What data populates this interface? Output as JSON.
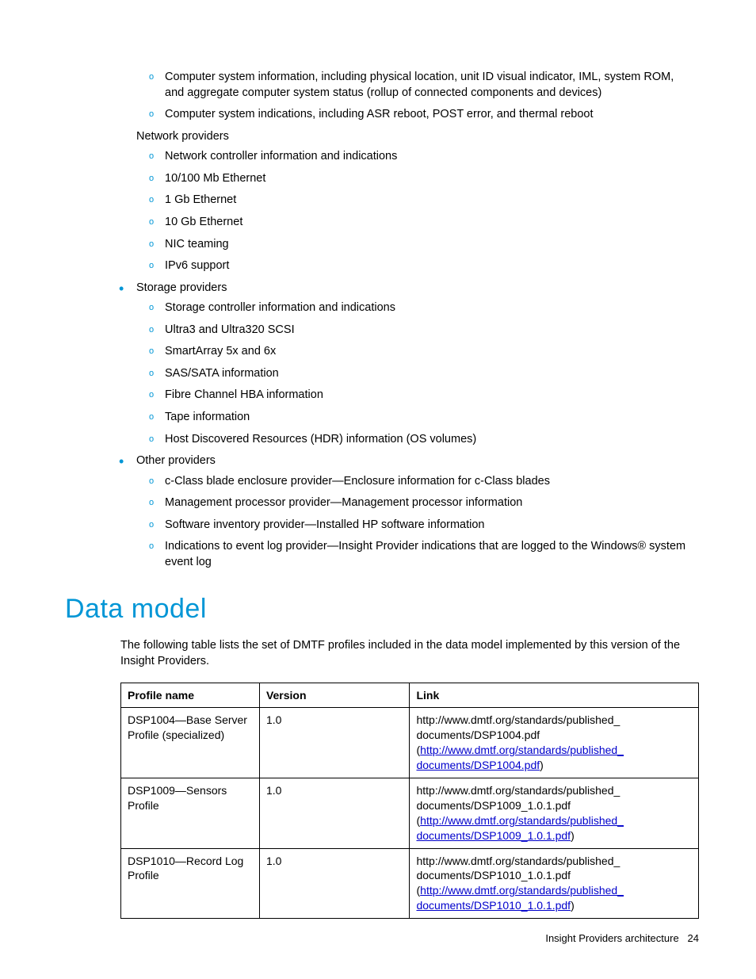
{
  "lists": {
    "orphan_level2_a": [
      "Computer system information, including physical location, unit ID visual indicator, IML, system ROM, and aggregate computer system status (rollup of connected components and devices)",
      "Computer system indications, including ASR reboot, POST error, and thermal reboot"
    ],
    "bullets": [
      {
        "label": "Network providers",
        "items": [
          "Network controller information and indications",
          "10/100 Mb Ethernet",
          "1 Gb Ethernet",
          "10 Gb Ethernet",
          "NIC teaming",
          "IPv6 support"
        ]
      },
      {
        "label": "Storage providers",
        "items": [
          "Storage controller information and indications",
          "Ultra3 and Ultra320 SCSI",
          "SmartArray 5x and 6x",
          "SAS/SATA information",
          "Fibre Channel HBA information",
          "Tape information",
          "Host Discovered Resources (HDR) information (OS volumes)"
        ]
      },
      {
        "label": "Other providers",
        "items": [
          "c-Class blade enclosure provider—Enclosure information for c-Class blades",
          "Management processor provider—Management processor information",
          "Software inventory provider—Installed HP software information",
          "Indications to event log provider—Insight Provider indications that are logged to the Windows® system event log"
        ]
      }
    ]
  },
  "section_title": "Data model",
  "intro": "The following table lists the set of DMTF profiles included in the data model implemented by this version of the Insight Providers.",
  "table": {
    "headers": [
      "Profile name",
      "Version",
      "Link"
    ],
    "rows": [
      {
        "name": "DSP1004—Base Server Profile (specialized)",
        "version": "1.0",
        "link_plain": "http://www.dmtf.org/standards/published_documents/DSP1004.pdf",
        "link_href": "http://www.dmtf.org/standards/published_documents/DSP1004.pdf"
      },
      {
        "name": "DSP1009—Sensors Profile",
        "version": "1.0",
        "link_plain": "http://www.dmtf.org/standards/published_documents/DSP1009_1.0.1.pdf",
        "link_href": "http://www.dmtf.org/standards/published_documents/DSP1009_1.0.1.pdf"
      },
      {
        "name": "DSP1010—Record Log Profile",
        "version": "1.0",
        "link_plain": "http://www.dmtf.org/standards/published_documents/DSP1010_1.0.1.pdf",
        "link_href": "http://www.dmtf.org/standards/published_documents/DSP1010_1.0.1.pdf"
      }
    ]
  },
  "footer": {
    "text": "Insight Providers architecture",
    "page": "24"
  }
}
